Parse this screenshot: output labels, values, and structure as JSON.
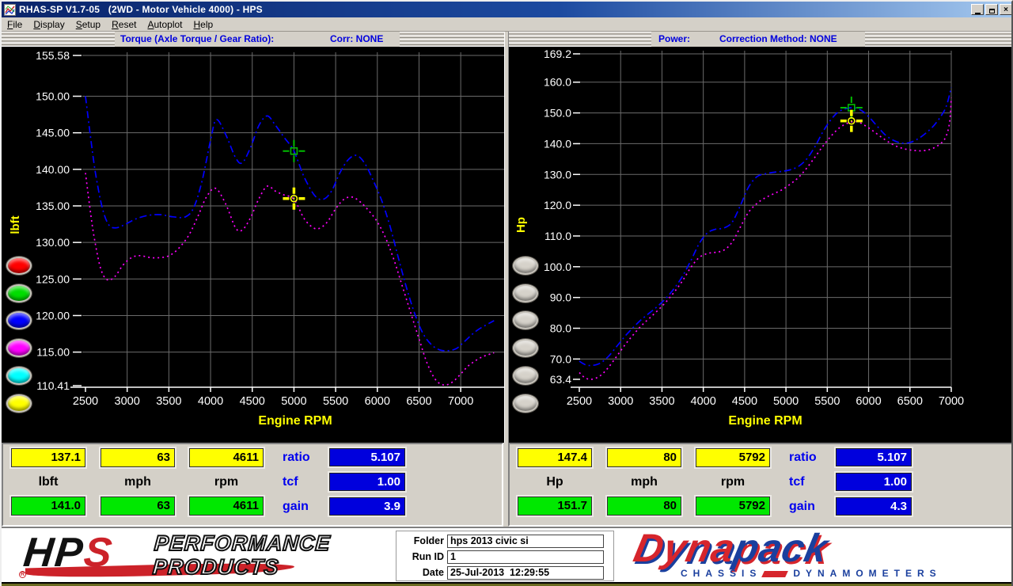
{
  "window": {
    "title": "RHAS-SP V1.7-05   (2WD - Motor Vehicle 4000) - HPS",
    "minimize": "minimize",
    "restore": "restore",
    "close": "close"
  },
  "menu": {
    "items": [
      "File",
      "Display",
      "Setup",
      "Reset",
      "Autoplot",
      "Help"
    ]
  },
  "headers": {
    "left": {
      "title": "Torque (Axle Torque / Gear Ratio):",
      "corr": "Corr: NONE"
    },
    "right": {
      "title": "Power:",
      "corr": "Correction Method: NONE"
    }
  },
  "run_buttons": {
    "left_colors": [
      "#ff0000",
      "#00dd00",
      "#0000ff",
      "#ff00ff",
      "#00ffff",
      "#ffff00"
    ],
    "right_colors": [
      "#d6d2ca",
      "#d6d2ca",
      "#d6d2ca",
      "#d6d2ca",
      "#d6d2ca",
      "#d6d2ca"
    ]
  },
  "readouts": {
    "left": {
      "values_yellow": [
        "137.1",
        "63",
        "4611"
      ],
      "units": [
        "lbft",
        "mph",
        "rpm"
      ],
      "values_green": [
        "141.0",
        "63",
        "4611"
      ],
      "side": [
        {
          "label": "ratio",
          "value": "5.107"
        },
        {
          "label": "tcf",
          "value": "1.00"
        },
        {
          "label": "gain",
          "value": "3.9"
        }
      ]
    },
    "right": {
      "values_yellow": [
        "147.4",
        "80",
        "5792"
      ],
      "units": [
        "Hp",
        "mph",
        "rpm"
      ],
      "values_green": [
        "151.7",
        "80",
        "5792"
      ],
      "side": [
        {
          "label": "ratio",
          "value": "5.107"
        },
        {
          "label": "tcf",
          "value": "1.00"
        },
        {
          "label": "gain",
          "value": "4.3"
        }
      ]
    }
  },
  "footer": {
    "fields": [
      {
        "label": "Folder",
        "value": "hps 2013 civic si"
      },
      {
        "label": "Run ID",
        "value": "1"
      },
      {
        "label": "Date",
        "value": "25-Jul-2013  12:29:55"
      }
    ]
  },
  "logos": {
    "hps": {
      "hp": "HP",
      "s": "S",
      "reg": "R",
      "line1": "PERFORMANCE",
      "line2": "PRODUCTS"
    },
    "dynapack": {
      "word_red": "Dyna",
      "word_blue": "pack",
      "sub_left": "CHASSIS",
      "sub_right": "DYNAMOMETERS"
    }
  },
  "colors": {
    "titlebar_start": "#0a246a",
    "titlebar_end": "#a6caf0",
    "chrome": "#d4d0c8",
    "chart_bg": "#000000",
    "grid": "#6b6b6b",
    "header_text": "#0000dd",
    "axis_unit": "#ffff00",
    "blue_series": "#0000ff",
    "magenta_series": "#ff00ff",
    "green_cursor": "#00bb00",
    "yellow_cursor": "#ffff00",
    "yellow_box": "#ffff00",
    "green_box": "#00e800",
    "blue_box": "#0000dd"
  },
  "chart_data": [
    {
      "type": "line",
      "title": "Torque (Axle Torque / Gear Ratio):",
      "corr": "Corr: NONE",
      "xlabel": "Engine RPM",
      "ylabel": "lbft",
      "xlim": [
        2500,
        7530
      ],
      "ylim": [
        110.41,
        155.58
      ],
      "grid": true,
      "x_ticks": [
        2500,
        3000,
        3500,
        4000,
        4500,
        5000,
        5500,
        6000,
        6500,
        7000
      ],
      "y_ticks": [
        155.58,
        150.0,
        145.0,
        140.0,
        135.0,
        130.0,
        125.0,
        120.0,
        115.0,
        110.41
      ],
      "y_tick_labels": [
        "155.58",
        "150.00",
        "145.00",
        "140.00",
        "135.00",
        "130.00",
        "125.00",
        "120.00",
        "115.00",
        "110.41"
      ],
      "series": [
        {
          "name": "blue-run",
          "color": "#0000ff",
          "style": "dashdot",
          "points": [
            [
              2500,
              150.0
            ],
            [
              2560,
              144.5
            ],
            [
              2620,
              139.5
            ],
            [
              2700,
              134.8
            ],
            [
              2780,
              132.4
            ],
            [
              2870,
              132.0
            ],
            [
              2980,
              132.5
            ],
            [
              3100,
              133.2
            ],
            [
              3250,
              133.7
            ],
            [
              3400,
              133.8
            ],
            [
              3550,
              133.5
            ],
            [
              3700,
              133.5
            ],
            [
              3800,
              134.8
            ],
            [
              3900,
              138.5
            ],
            [
              4000,
              144.0
            ],
            [
              4070,
              146.8
            ],
            [
              4180,
              144.8
            ],
            [
              4300,
              141.6
            ],
            [
              4380,
              140.9
            ],
            [
              4480,
              143.0
            ],
            [
              4580,
              146.0
            ],
            [
              4680,
              147.3
            ],
            [
              4780,
              146.0
            ],
            [
              4880,
              144.4
            ],
            [
              5000,
              142.5
            ],
            [
              5120,
              139.0
            ],
            [
              5250,
              136.4
            ],
            [
              5350,
              135.9
            ],
            [
              5450,
              137.0
            ],
            [
              5550,
              139.5
            ],
            [
              5650,
              141.3
            ],
            [
              5750,
              141.9
            ],
            [
              5850,
              140.8
            ],
            [
              5950,
              138.5
            ],
            [
              6050,
              135.8
            ],
            [
              6150,
              132.3
            ],
            [
              6250,
              128.0
            ],
            [
              6350,
              123.8
            ],
            [
              6450,
              120.2
            ],
            [
              6550,
              117.5
            ],
            [
              6650,
              116.0
            ],
            [
              6750,
              115.3
            ],
            [
              6850,
              115.2
            ],
            [
              6950,
              115.5
            ],
            [
              7050,
              116.5
            ],
            [
              7200,
              118.0
            ],
            [
              7400,
              119.3
            ]
          ]
        },
        {
          "name": "magenta-run",
          "color": "#ff00ff",
          "style": "dot",
          "points": [
            [
              2500,
              139.5
            ],
            [
              2550,
              135.0
            ],
            [
              2600,
              131.0
            ],
            [
              2680,
              126.5
            ],
            [
              2760,
              124.9
            ],
            [
              2850,
              125.3
            ],
            [
              2950,
              126.9
            ],
            [
              3050,
              127.9
            ],
            [
              3150,
              128.2
            ],
            [
              3300,
              127.9
            ],
            [
              3450,
              128.0
            ],
            [
              3550,
              128.5
            ],
            [
              3650,
              129.6
            ],
            [
              3750,
              131.2
            ],
            [
              3850,
              133.6
            ],
            [
              3950,
              136.2
            ],
            [
              4060,
              137.4
            ],
            [
              4180,
              135.3
            ],
            [
              4300,
              132.0
            ],
            [
              4380,
              131.7
            ],
            [
              4480,
              133.4
            ],
            [
              4580,
              136.0
            ],
            [
              4680,
              137.7
            ],
            [
              4780,
              137.0
            ],
            [
              4880,
              136.5
            ],
            [
              5000,
              135.9
            ],
            [
              5120,
              133.3
            ],
            [
              5220,
              132.1
            ],
            [
              5300,
              131.9
            ],
            [
              5400,
              132.8
            ],
            [
              5500,
              134.6
            ],
            [
              5600,
              135.9
            ],
            [
              5700,
              136.2
            ],
            [
              5800,
              135.5
            ],
            [
              5900,
              134.3
            ],
            [
              6000,
              132.8
            ],
            [
              6100,
              130.6
            ],
            [
              6200,
              127.6
            ],
            [
              6300,
              124.0
            ],
            [
              6400,
              120.4
            ],
            [
              6500,
              116.8
            ],
            [
              6600,
              113.4
            ],
            [
              6700,
              111.2
            ],
            [
              6800,
              110.5
            ],
            [
              6900,
              110.9
            ],
            [
              7000,
              112.0
            ],
            [
              7100,
              113.2
            ],
            [
              7250,
              114.3
            ],
            [
              7400,
              114.9
            ]
          ]
        }
      ],
      "cursors": [
        {
          "name": "green-cursor",
          "color": "#00bb00",
          "shape": "square",
          "rpm": 5000,
          "value": 142.5
        },
        {
          "name": "yellow-cursor",
          "color": "#ffff00",
          "shape": "circle",
          "rpm": 5000,
          "value": 136.0
        }
      ]
    },
    {
      "type": "line",
      "title": "Power:",
      "corr": "Correction Method: NONE",
      "xlabel": "Engine RPM",
      "ylabel": "Hp",
      "xlim": [
        2500,
        7000
      ],
      "ylim": [
        63.4,
        169.2
      ],
      "grid": true,
      "x_ticks": [
        2500,
        3000,
        3500,
        4000,
        4500,
        5000,
        5500,
        6000,
        6500,
        7000
      ],
      "y_ticks": [
        169.2,
        160.0,
        150.0,
        140.0,
        130.0,
        120.0,
        110.0,
        100.0,
        90.0,
        80.0,
        70.0,
        63.4
      ],
      "y_tick_labels": [
        "169.2",
        "160.0",
        "150.0",
        "140.0",
        "130.0",
        "120.0",
        "110.0",
        "100.0",
        "90.0",
        "80.0",
        "70.0",
        "63.4"
      ],
      "series": [
        {
          "name": "blue-run",
          "color": "#0000ff",
          "style": "dashdot",
          "points": [
            [
              2500,
              69.3
            ],
            [
              2570,
              68.2
            ],
            [
              2650,
              67.9
            ],
            [
              2750,
              68.6
            ],
            [
              2850,
              70.8
            ],
            [
              2950,
              74.0
            ],
            [
              3050,
              77.3
            ],
            [
              3150,
              80.2
            ],
            [
              3250,
              82.8
            ],
            [
              3350,
              85.0
            ],
            [
              3450,
              87.2
            ],
            [
              3550,
              89.8
            ],
            [
              3650,
              93.0
            ],
            [
              3750,
              97.0
            ],
            [
              3850,
              102.0
            ],
            [
              3950,
              107.5
            ],
            [
              4050,
              111.0
            ],
            [
              4150,
              112.2
            ],
            [
              4250,
              112.6
            ],
            [
              4350,
              114.5
            ],
            [
              4450,
              120.0
            ],
            [
              4550,
              126.0
            ],
            [
              4650,
              129.3
            ],
            [
              4750,
              130.2
            ],
            [
              4850,
              130.7
            ],
            [
              4950,
              131.0
            ],
            [
              5050,
              131.5
            ],
            [
              5150,
              132.6
            ],
            [
              5250,
              135.0
            ],
            [
              5350,
              139.0
            ],
            [
              5450,
              144.0
            ],
            [
              5550,
              148.0
            ],
            [
              5650,
              150.6
            ],
            [
              5790,
              151.7
            ],
            [
              5900,
              151.0
            ],
            [
              6000,
              148.8
            ],
            [
              6100,
              145.8
            ],
            [
              6200,
              142.9
            ],
            [
              6300,
              141.1
            ],
            [
              6400,
              140.2
            ],
            [
              6500,
              140.4
            ],
            [
              6600,
              141.6
            ],
            [
              6700,
              143.6
            ],
            [
              6800,
              146.2
            ],
            [
              6900,
              150.0
            ],
            [
              6950,
              153.0
            ],
            [
              7000,
              158.3
            ]
          ]
        },
        {
          "name": "magenta-run",
          "color": "#ff00ff",
          "style": "dot",
          "points": [
            [
              2500,
              65.6
            ],
            [
              2570,
              63.9
            ],
            [
              2650,
              63.4
            ],
            [
              2750,
              64.5
            ],
            [
              2850,
              67.2
            ],
            [
              2950,
              70.8
            ],
            [
              3050,
              74.5
            ],
            [
              3150,
              77.8
            ],
            [
              3250,
              80.8
            ],
            [
              3350,
              83.3
            ],
            [
              3450,
              85.8
            ],
            [
              3550,
              88.6
            ],
            [
              3650,
              91.8
            ],
            [
              3750,
              95.5
            ],
            [
              3850,
              99.8
            ],
            [
              3950,
              103.0
            ],
            [
              4050,
              104.3
            ],
            [
              4150,
              104.7
            ],
            [
              4250,
              105.4
            ],
            [
              4350,
              108.0
            ],
            [
              4450,
              113.0
            ],
            [
              4550,
              117.8
            ],
            [
              4650,
              120.6
            ],
            [
              4750,
              122.4
            ],
            [
              4850,
              123.7
            ],
            [
              4950,
              125.0
            ],
            [
              5050,
              126.8
            ],
            [
              5150,
              129.0
            ],
            [
              5250,
              132.0
            ],
            [
              5350,
              135.6
            ],
            [
              5450,
              139.3
            ],
            [
              5550,
              142.6
            ],
            [
              5650,
              145.2
            ],
            [
              5750,
              146.7
            ],
            [
              5850,
              147.2
            ],
            [
              5950,
              146.0
            ],
            [
              6050,
              144.2
            ],
            [
              6150,
              142.2
            ],
            [
              6250,
              140.4
            ],
            [
              6350,
              139.0
            ],
            [
              6450,
              138.2
            ],
            [
              6550,
              137.8
            ],
            [
              6650,
              137.7
            ],
            [
              6750,
              138.2
            ],
            [
              6850,
              139.6
            ],
            [
              6930,
              142.0
            ],
            [
              6980,
              147.0
            ],
            [
              7000,
              155.0
            ]
          ]
        }
      ],
      "cursors": [
        {
          "name": "green-cursor",
          "color": "#00bb00",
          "shape": "square",
          "rpm": 5792,
          "value": 151.7
        },
        {
          "name": "yellow-cursor",
          "color": "#ffff00",
          "shape": "circle",
          "rpm": 5792,
          "value": 147.4
        }
      ]
    }
  ]
}
